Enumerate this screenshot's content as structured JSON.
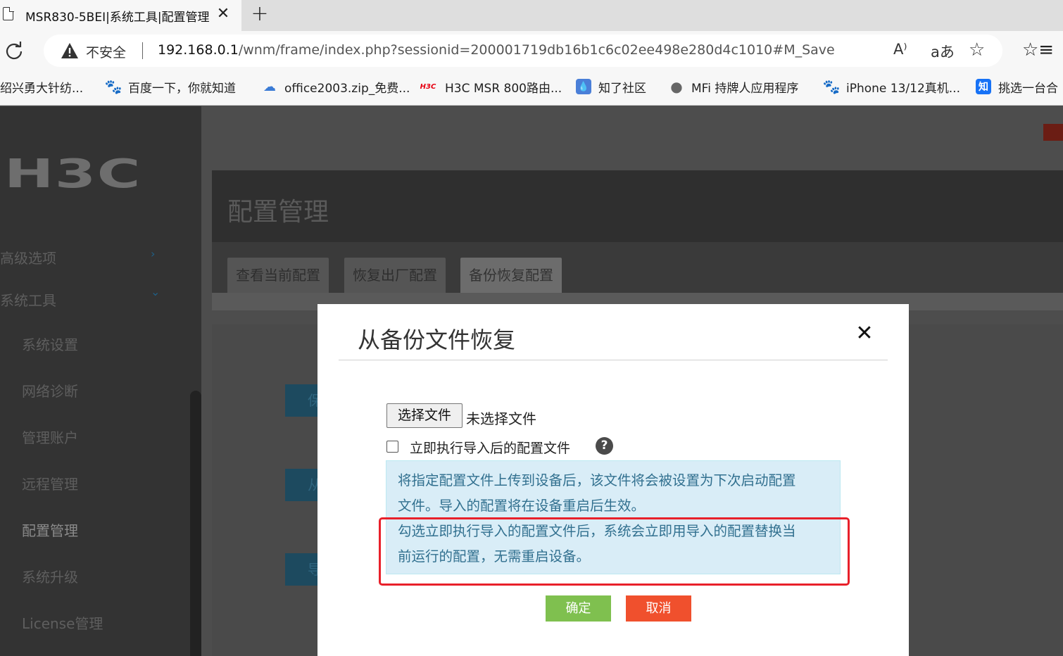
{
  "browser": {
    "tab_title": "MSR830-5BEI|系统工具|配置管理",
    "tab_close": "✕",
    "new_tab": "+",
    "security_label": "不安全",
    "url_host": "192.168.0.1",
    "url_path": "/wnm/frame/index.php?sessionid=200001719db16b1c6c02ee498e280d4c1010#M_Save",
    "read_aloud": "A⁾",
    "translate": "aあ",
    "add_favorite": "☆",
    "favorites": "☆≡"
  },
  "bookmarks": [
    {
      "label": "绍兴勇大针纺...",
      "icon": ""
    },
    {
      "label": "百度一下，你就知道",
      "icon": "🐾"
    },
    {
      "label": "office2003.zip_免费...",
      "icon": "☁"
    },
    {
      "label": "H3C MSR 800路由...",
      "icon": "H3C"
    },
    {
      "label": "知了社区",
      "icon": "💧"
    },
    {
      "label": "MFi 持牌人应用程序",
      "icon": ""
    },
    {
      "label": "iPhone 13/12真机...",
      "icon": "🐾"
    },
    {
      "label": "挑选一台合",
      "icon": "知"
    }
  ],
  "sidebar": {
    "logo": "H3C",
    "sections": [
      {
        "label": "高级选项",
        "chevron": "›"
      },
      {
        "label": "系统工具",
        "chevron": "⌄"
      }
    ],
    "items": [
      {
        "label": "系统设置"
      },
      {
        "label": "网络诊断"
      },
      {
        "label": "管理账户"
      },
      {
        "label": "远程管理"
      },
      {
        "label": "配置管理"
      },
      {
        "label": "系统升级"
      },
      {
        "label": "License管理"
      }
    ]
  },
  "main": {
    "page_title": "配置管理",
    "tabs": [
      {
        "label": "查看当前配置"
      },
      {
        "label": "恢复出厂配置"
      },
      {
        "label": "备份恢复配置"
      }
    ],
    "bg_buttons": [
      "保存",
      "从备",
      "导出"
    ]
  },
  "modal": {
    "title": "从备份文件恢复",
    "close": "✕",
    "choose_file_label": "选择文件",
    "file_status": "未选择文件",
    "checkbox_label": "立即执行导入后的配置文件",
    "help": "?",
    "info_lines": [
      "将指定配置文件上传到设备后，该文件将会被设置为下次启动配置",
      "文件。导入的配置将在设备重启后生效。",
      "勾选立即执行导入的配置文件后，系统会立即用导入的配置替换当",
      "前运行的配置，无需重启设备。"
    ],
    "ok_label": "确定",
    "cancel_label": "取消"
  },
  "colors": {
    "ok": "#7fc04f",
    "cancel": "#f0502d",
    "info_bg": "#d9edf7",
    "info_text": "#31708f",
    "highlight": "#e8202a"
  }
}
